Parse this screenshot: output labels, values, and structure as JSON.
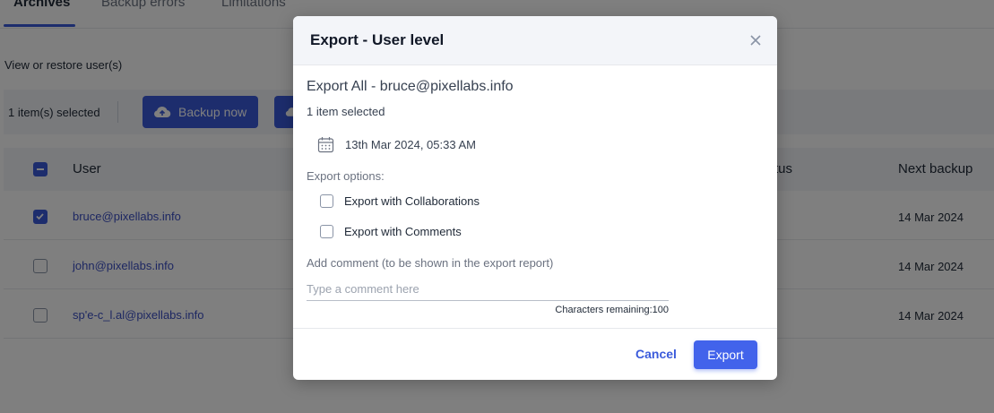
{
  "tabs": [
    "Archives",
    "Backup errors",
    "Limitations"
  ],
  "page": {
    "subtitle": "View or restore user(s)"
  },
  "action_bar": {
    "selected_count": "1 item(s) selected",
    "backup_now_label": "Backup now"
  },
  "table": {
    "columns": {
      "user": "User",
      "status_partial": "tus",
      "next_backup": "Next backup"
    },
    "rows": [
      {
        "user": "bruce@pixellabs.info",
        "next_backup": "14 Mar 2024",
        "checked": true
      },
      {
        "user": "john@pixellabs.info",
        "next_backup": "14 Mar 2024",
        "checked": false
      },
      {
        "user": "sp'e-c_l.al@pixellabs.info",
        "next_backup": "14 Mar 2024",
        "checked": false
      }
    ]
  },
  "modal": {
    "title": "Export - User level",
    "heading": "Export All -  bruce@pixellabs.info",
    "items_selected": "1 item selected",
    "date": "13th Mar 2024, 05:33 AM",
    "export_options_label": "Export options:",
    "options": [
      {
        "label": "Export with Collaborations",
        "checked": false
      },
      {
        "label": "Export with Comments",
        "checked": false
      }
    ],
    "comment_label": "Add comment (to be shown in the export report)",
    "comment_placeholder": "Type a comment here",
    "comment_value": "",
    "chars_remaining": "Characters remaining:100",
    "cancel_label": "Cancel",
    "export_label": "Export"
  },
  "colors": {
    "accent": "#3b5bdb",
    "primary_button": "#4263eb",
    "overlay": "rgba(0,0,0,0.5)"
  },
  "icons": {
    "close": "close-icon",
    "calendar": "calendar-icon",
    "cloud_upload": "cloud-upload-icon"
  }
}
